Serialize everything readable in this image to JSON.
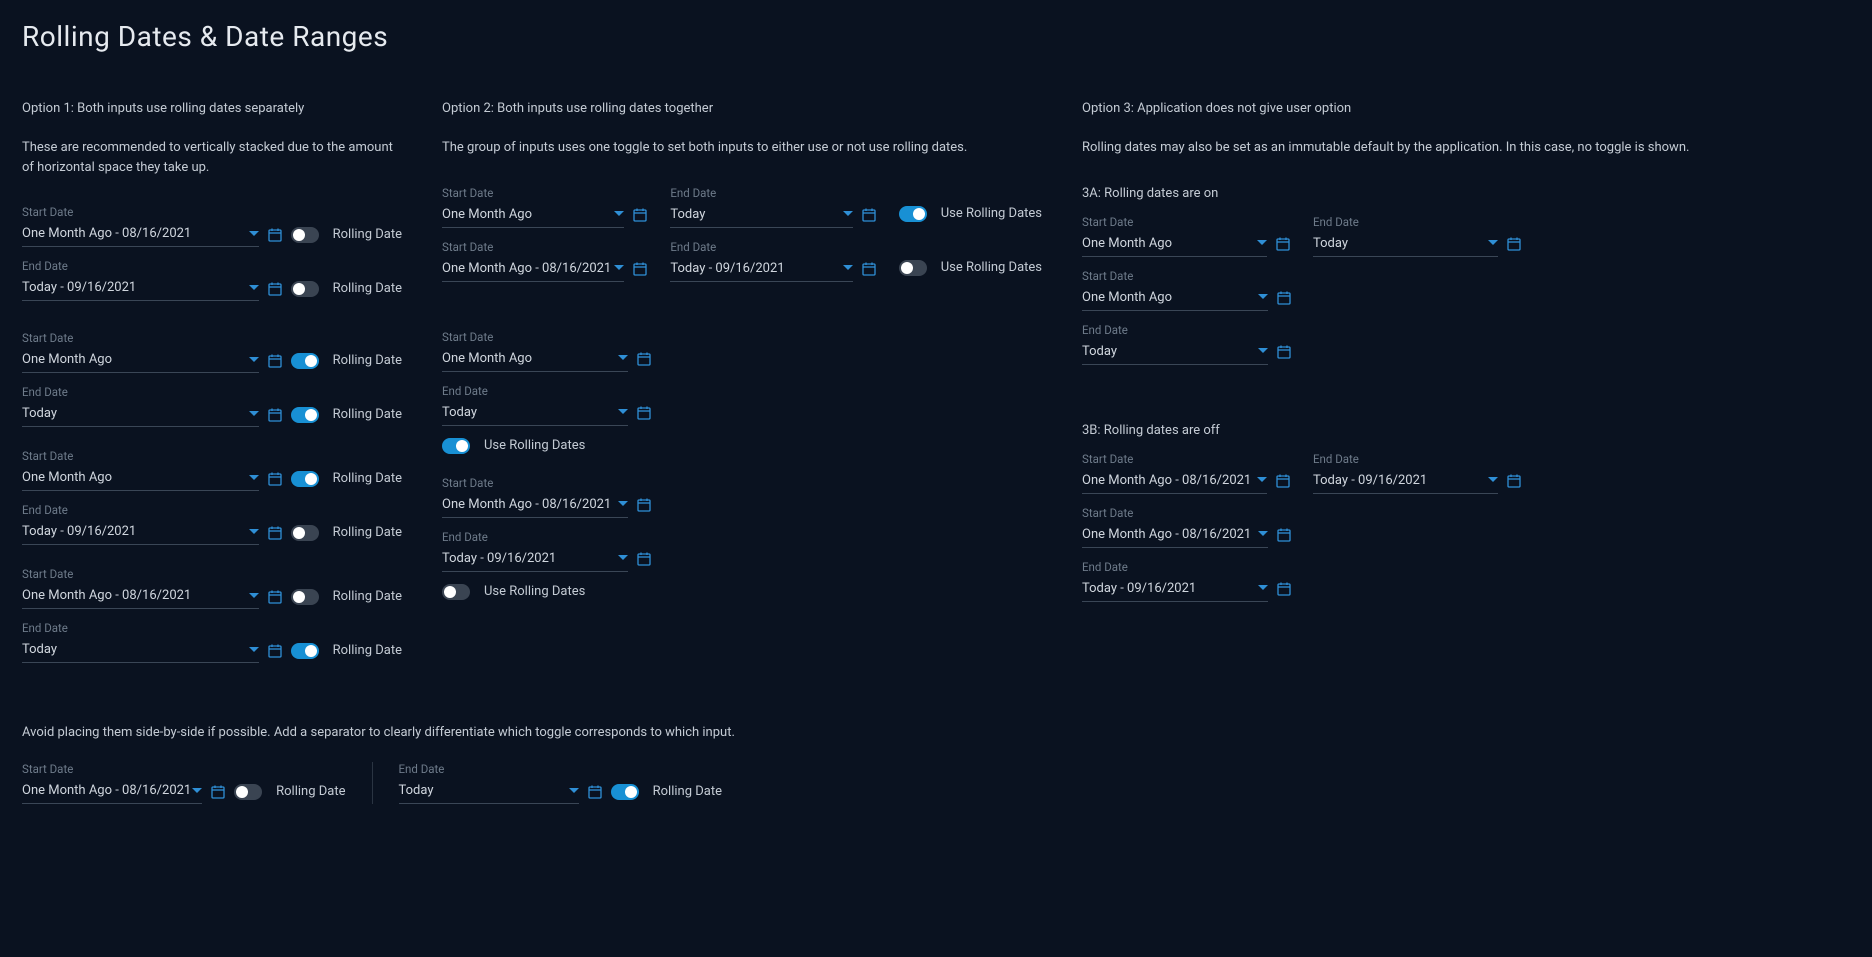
{
  "title": "Rolling Dates & Date Ranges",
  "labels": {
    "start": "Start Date",
    "end": "End Date",
    "rolling": "Rolling Date",
    "useRolling": "Use Rolling Dates"
  },
  "option1": {
    "title": "Option 1: Both inputs use rolling dates separately",
    "desc": "These are recommended to vertically stacked due to the amount of horizontal space they take up.",
    "groups": [
      {
        "start": "One Month Ago - 08/16/2021",
        "startOn": false,
        "end": "Today - 09/16/2021",
        "endOn": false
      },
      {
        "start": "One Month Ago",
        "startOn": true,
        "end": "Today",
        "endOn": true
      },
      {
        "start": "One Month Ago",
        "startOn": true,
        "end": "Today - 09/16/2021",
        "endOn": false
      },
      {
        "start": "One Month Ago - 08/16/2021",
        "startOn": false,
        "end": "Today",
        "endOn": true
      }
    ],
    "note": "Avoid placing them side-by-side if possible. Add a separator to clearly differentiate which toggle corresponds to which input.",
    "sideBySide": {
      "start": "One Month Ago - 08/16/2021",
      "startOn": false,
      "end": "Today",
      "endOn": true
    }
  },
  "option2": {
    "title": "Option 2: Both inputs use rolling dates together",
    "desc": "The group of inputs uses one toggle to set both inputs to either use or not use rolling dates.",
    "rows": [
      {
        "start": "One Month Ago",
        "end": "Today",
        "on": true
      },
      {
        "start": "One Month Ago - 08/16/2021",
        "end": "Today - 09/16/2021",
        "on": false
      }
    ],
    "stacks": [
      {
        "start": "One Month Ago",
        "end": "Today",
        "on": true
      },
      {
        "start": "One Month Ago - 08/16/2021",
        "end": "Today - 09/16/2021",
        "on": false
      }
    ]
  },
  "option3": {
    "title": "Option 3: Application does not give user option",
    "desc": "Rolling dates may also be set as an immutable default by the application. In this case, no toggle is shown.",
    "a": {
      "title": "3A: Rolling dates are on",
      "row": {
        "start": "One Month Ago",
        "end": "Today"
      },
      "stack": {
        "start": "One Month Ago",
        "end": "Today"
      }
    },
    "b": {
      "title": "3B: Rolling dates are off",
      "row": {
        "start": "One Month Ago - 08/16/2021",
        "end": "Today - 09/16/2021"
      },
      "stack": {
        "start": "One Month Ago - 08/16/2021",
        "end": "Today - 09/16/2021"
      }
    }
  }
}
